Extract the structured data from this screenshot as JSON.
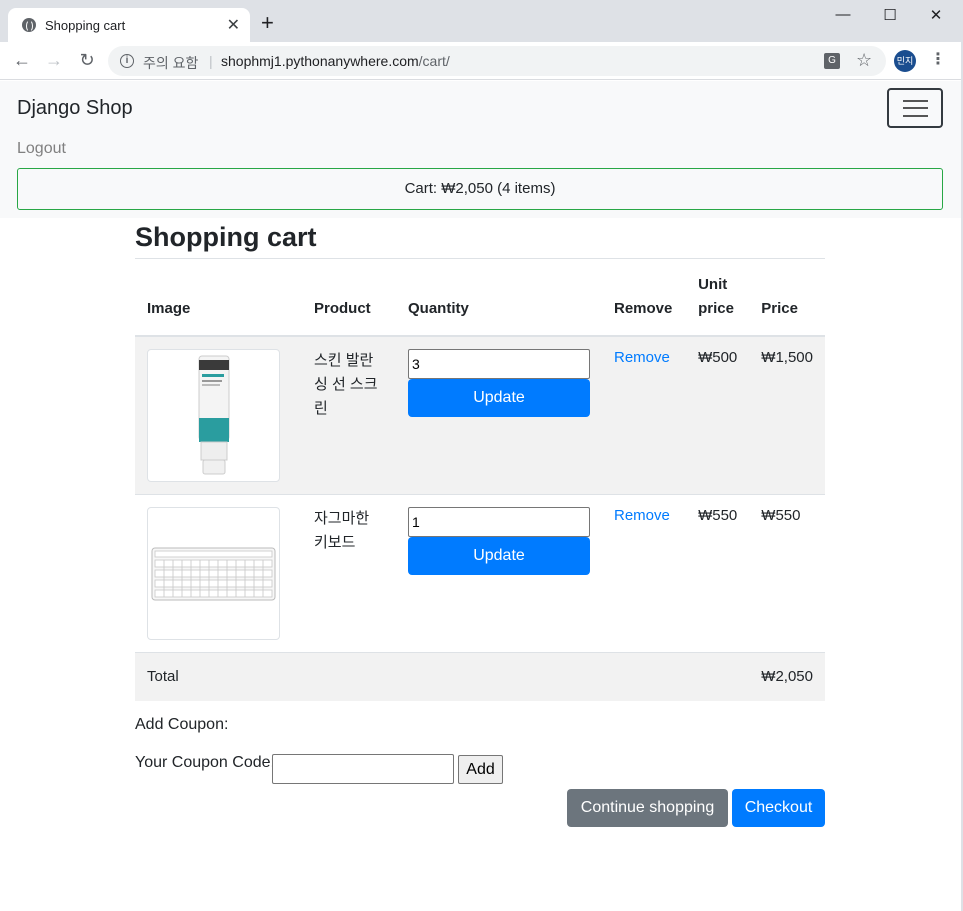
{
  "browser": {
    "tab_title": "Shopping cart",
    "tab_close": "✕",
    "new_tab": "+",
    "security_label": "주의 요함",
    "url_host": "shophmj1.pythonanywhere.com",
    "url_path": "/cart/",
    "profile_label": "민지",
    "window_controls": {
      "minimize": "—",
      "maximize": "☐",
      "close": "✕"
    }
  },
  "navbar": {
    "brand": "Django Shop",
    "logout": "Logout",
    "cart_summary": "Cart: ₩2,050 (4 items)"
  },
  "page": {
    "title": "Shopping cart"
  },
  "table": {
    "headers": {
      "image": "Image",
      "product": "Product",
      "quantity": "Quantity",
      "remove": "Remove",
      "unit_price": "Unit price",
      "price": "Price"
    },
    "rows": [
      {
        "product": "스킨 발란싱 선 스크린",
        "quantity": "3",
        "update_label": "Update",
        "remove_label": "Remove",
        "unit_price": "₩500",
        "price": "₩1,500",
        "image_icon": "sunscreen-tube-icon"
      },
      {
        "product": "자그마한 키보드",
        "quantity": "1",
        "update_label": "Update",
        "remove_label": "Remove",
        "unit_price": "₩550",
        "price": "₩550",
        "image_icon": "keyboard-icon"
      }
    ],
    "total_label": "Total",
    "total_value": "₩2,050"
  },
  "coupon": {
    "heading": "Add Coupon:",
    "label": "Your Coupon Code:",
    "value": "",
    "add_label": "Add"
  },
  "actions": {
    "continue_label": "Continue shopping",
    "checkout_label": "Checkout"
  },
  "colors": {
    "primary": "#007bff",
    "secondary": "#6c757d",
    "success_border": "#28a745"
  }
}
